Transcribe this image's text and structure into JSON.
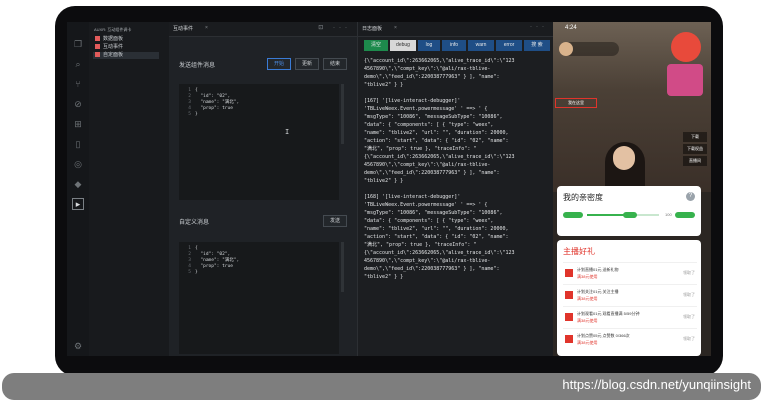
{
  "explorer": {
    "title": "AUXR: 互动组件调卡",
    "items": [
      "数据面板",
      "互动事件",
      "自定面板"
    ]
  },
  "editor": {
    "tab_label": "互动事件",
    "tab_close": "×",
    "tools": "⊡ ···",
    "section1_label": "发送组件消息",
    "buttons": [
      "开始",
      "更新",
      "结束"
    ],
    "code1": [
      {
        "ln": "1",
        "text": "{"
      },
      {
        "ln": "2",
        "text": "  \"id\": \"02\","
      },
      {
        "ln": "3",
        "text": "  \"name\": \"满北\","
      },
      {
        "ln": "4",
        "text": "  \"prop\": true"
      },
      {
        "ln": "5",
        "text": "}"
      }
    ],
    "section2_label": "自定义消息",
    "send_label": "发送",
    "code2": [
      {
        "ln": "1",
        "text": "{"
      },
      {
        "ln": "2",
        "text": "  \"id\": \"02\","
      },
      {
        "ln": "3",
        "text": "  \"name\": \"满北\","
      },
      {
        "ln": "4",
        "text": "  \"prop\": true"
      },
      {
        "ln": "5",
        "text": "}"
      }
    ]
  },
  "log": {
    "tab_label": "日志面板",
    "tab_close": "×",
    "tools": "···",
    "filters": [
      "清空",
      "debug",
      "log",
      "info",
      "warn",
      "error",
      "搜 索"
    ],
    "lines": [
      "{\\\"account_id\\\":263662065,\\\"alive_trace_id\\\":\\\"123",
      "4567890\\\",\\\"compt_key\\\":\\\"@ali/rax-tblive-",
      "demo\\\",\\\"feed_id\\\":220038777963\" } ], \"name\":",
      "\"tblive2\" } }",
      "",
      "[167] '[live-interact-debugger]'",
      "'TBLiveWeex.Event.powermessage' ' ==> ' {",
      "\"msgType\": \"10086\", \"messageSubType\": \"10086\",",
      "\"data\": { \"components\": [ { \"type\": \"weex\",",
      "\"name\": \"tblive2\", \"url\": \"\", \"duration\": 20000,",
      "\"action\": \"start\", \"data\": { \"id\": \"02\", \"name\":",
      "\"满北\", \"prop\": true }, \"traceInfo\": \"",
      "{\\\"account_id\\\":263662065,\\\"alive_trace_id\\\":\\\"123",
      "4567890\\\",\\\"compt_key\\\":\\\"@ali/rax-tblive-",
      "demo\\\",\\\"feed_id\\\":220038777963\" } ], \"name\":",
      "\"tblive2\" } }",
      "",
      "[168] '[live-interact-debugger]'",
      "'TBLiveWeex.Event.powermessage' ' ==> ' {",
      "\"msgType\": \"10086\", \"messageSubType\": \"10086\",",
      "\"data\": { \"components\": [ { \"type\": \"weex\",",
      "\"name\": \"tblive2\", \"url\": \"\", \"duration\": 20000,",
      "\"action\": \"start\", \"data\": { \"id\": \"02\", \"name\":",
      "\"满北\", \"prop\": true }, \"traceInfo\": \"",
      "{\\\"account_id\\\":263662065,\\\"alive_trace_id\\\":\\\"123",
      "4567890\\\",\\\"compt_key\\\":\\\"@ali/rax-tblive-",
      "demo\\\",\\\"feed_id\\\":220038777963\" } ], \"name\":",
      "\"tblive2\" } }"
    ]
  },
  "phone": {
    "time": "4:24",
    "side_buttons": [
      "下载",
      "下载权益",
      "直播间"
    ],
    "redbox_text": "我在这里",
    "card1": {
      "title": "我的亲密度",
      "help": "?",
      "value_label": "100"
    },
    "card2": {
      "title": "主播好礼",
      "rows": [
        {
          "l1": "计划直播01元  送新礼物",
          "l2": "满38元使用",
          "r": "领取了"
        },
        {
          "l1": "计划关注01元  关注主播",
          "l2": "满38元使用",
          "r": "领取了"
        },
        {
          "l1": "计划观看01元  观看直播满 5/59分钟",
          "l2": "满38元使用",
          "r": "领取了"
        },
        {
          "l1": "计划点赞05元  点赞数 0/366次",
          "l2": "满38元使用",
          "r": "领取了"
        }
      ]
    }
  },
  "caption": {
    "url": "https://blog.csdn.net/yunqiinsight"
  }
}
